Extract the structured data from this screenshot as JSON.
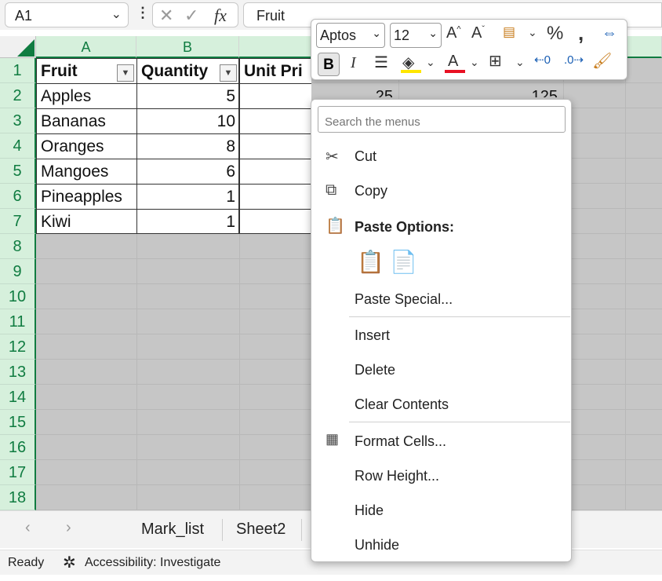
{
  "formula_bar": {
    "name_box": "A1",
    "formula": "Fruit",
    "fx": "fx"
  },
  "columns": [
    "A",
    "B"
  ],
  "rows": [
    "1",
    "2",
    "3",
    "4",
    "5",
    "6",
    "7",
    "8",
    "9",
    "10",
    "11",
    "12",
    "13",
    "14",
    "15",
    "16",
    "17",
    "18"
  ],
  "table": {
    "headers": [
      "Fruit",
      "Quantity",
      "Unit Pri"
    ],
    "body": [
      {
        "fruit": "Apples",
        "qty": "5"
      },
      {
        "fruit": "Bananas",
        "qty": "10"
      },
      {
        "fruit": "Oranges",
        "qty": "8"
      },
      {
        "fruit": "Mangoes",
        "qty": "6"
      },
      {
        "fruit": "Pineapples",
        "qty": "1"
      },
      {
        "fruit": "Kiwi",
        "qty": "1"
      }
    ],
    "partial_values": [
      "25",
      "125"
    ]
  },
  "mini_toolbar": {
    "font": "Aptos",
    "size": "12",
    "bold": "B",
    "italic": "I"
  },
  "context_menu": {
    "search_placeholder": "Search the menus",
    "paste_options_label": "Paste Options:",
    "items": {
      "cut": "Cut",
      "copy": "Copy",
      "paste_special": "Paste Special...",
      "insert": "Insert",
      "delete": "Delete",
      "clear": "Clear Contents",
      "format_cells": "Format Cells...",
      "row_height": "Row Height...",
      "hide": "Hide",
      "unhide": "Unhide"
    }
  },
  "sheet_tabs": [
    "Mark_list",
    "Sheet2"
  ],
  "status": {
    "ready": "Ready",
    "accessibility": "Accessibility: Investigate"
  },
  "colors": {
    "accent_green": "#107c41",
    "selection_gray": "#c6c6c6"
  }
}
